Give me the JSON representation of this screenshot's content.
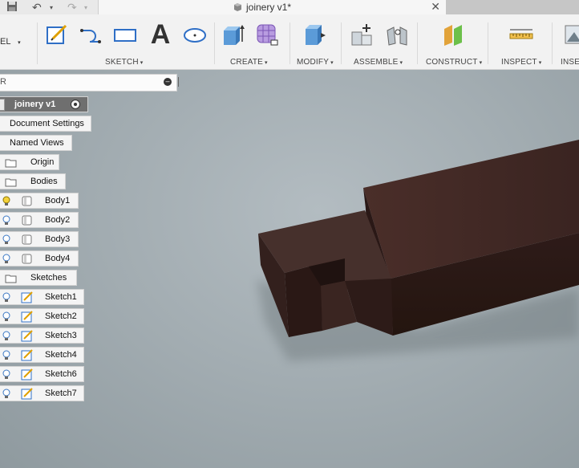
{
  "title_bar": {
    "document_title": "joinery v1*",
    "close_symbol": "✕",
    "save_icon": "save-icon",
    "undo_icon": "undo-icon",
    "redo_icon": "redo-icon"
  },
  "toolbar": {
    "workspace_label": "EL",
    "groups": [
      {
        "label": "SKETCH"
      },
      {
        "label": "CREATE"
      },
      {
        "label": "MODIFY"
      },
      {
        "label": "ASSEMBLE"
      },
      {
        "label": "CONSTRUCT"
      },
      {
        "label": "INSPECT"
      },
      {
        "label": "INSE"
      }
    ],
    "text_tool_glyph": "A",
    "caret": "▾"
  },
  "browser": {
    "search_prefix": "R",
    "root": {
      "label": "joinery v1"
    },
    "document_settings": "Document Settings",
    "named_views": "Named Views",
    "origin": "Origin",
    "bodies": {
      "label": "Bodies",
      "items": [
        "Body1",
        "Body2",
        "Body3",
        "Body4"
      ]
    },
    "sketches": {
      "label": "Sketches",
      "items": [
        "Sketch1",
        "Sketch2",
        "Sketch3",
        "Sketch4",
        "Sketch6",
        "Sketch7"
      ]
    }
  },
  "colors": {
    "viewport_bg": "#a3adb2",
    "wood": "#3b2421",
    "accent_blue": "#2f6fc6",
    "sketch_yellow": "#f0c000"
  }
}
